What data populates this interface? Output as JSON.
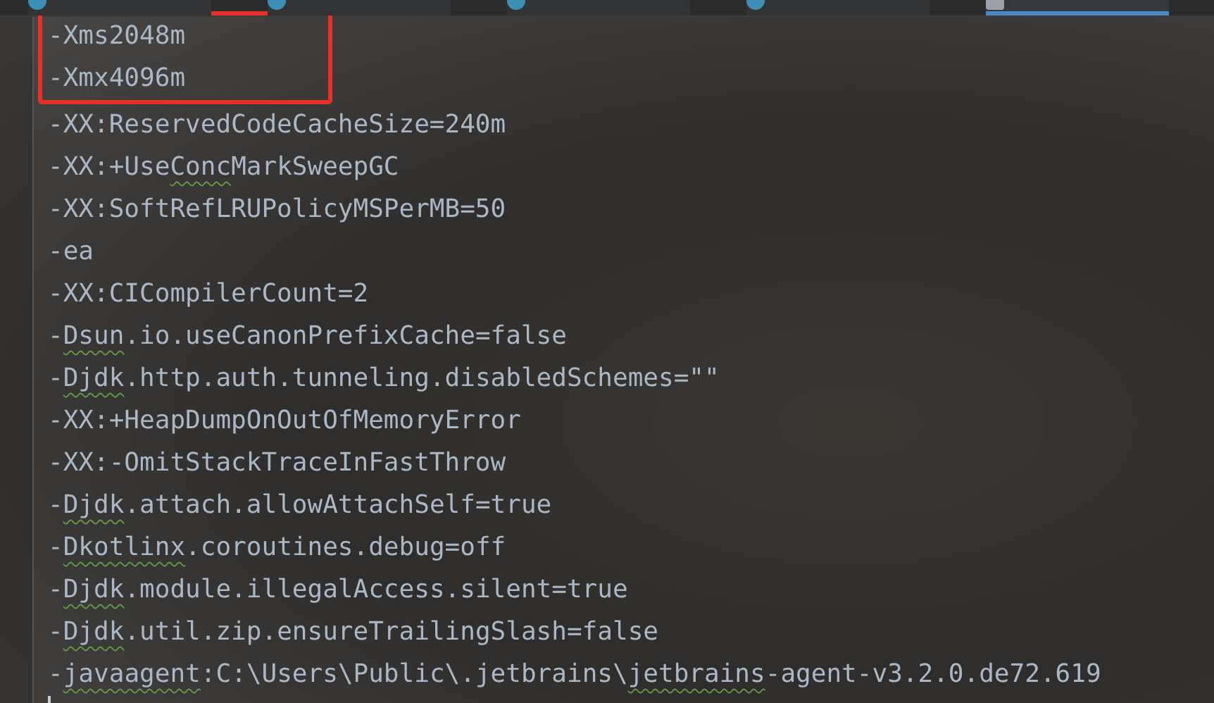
{
  "tabs": [
    {
      "selected": false
    },
    {
      "selected": false
    },
    {
      "selected": false
    },
    {
      "selected": false
    },
    {
      "selected": true
    }
  ],
  "lines": [
    {
      "highlighted": true,
      "segments": [
        {
          "text": "-Xms2048m",
          "warning": false
        }
      ]
    },
    {
      "highlighted": true,
      "segments": [
        {
          "text": "-Xmx4096m",
          "warning": false
        }
      ]
    },
    {
      "highlighted": false,
      "segments": [
        {
          "text": "-XX:ReservedCodeCacheSize=240m",
          "warning": false
        }
      ]
    },
    {
      "highlighted": false,
      "segments": [
        {
          "text": "-XX:+Use",
          "warning": false
        },
        {
          "text": "Conc",
          "warning": true
        },
        {
          "text": "MarkSweepGC",
          "warning": false
        }
      ]
    },
    {
      "highlighted": false,
      "segments": [
        {
          "text": "-XX:SoftRefLRUPolicyMSPerMB=50",
          "warning": false
        }
      ]
    },
    {
      "highlighted": false,
      "segments": [
        {
          "text": "-ea",
          "warning": false
        }
      ]
    },
    {
      "highlighted": false,
      "segments": [
        {
          "text": "-XX:CICompilerCount=2",
          "warning": false
        }
      ]
    },
    {
      "highlighted": false,
      "segments": [
        {
          "text": "-",
          "warning": false
        },
        {
          "text": "Dsun",
          "warning": true
        },
        {
          "text": ".io.useCanonPrefixCache=false",
          "warning": false
        }
      ]
    },
    {
      "highlighted": false,
      "segments": [
        {
          "text": "-",
          "warning": false
        },
        {
          "text": "Djdk",
          "warning": true
        },
        {
          "text": ".http.auth.tunneling.disabledSchemes=\"\"",
          "warning": false
        }
      ]
    },
    {
      "highlighted": false,
      "segments": [
        {
          "text": "-XX:+HeapDumpOnOutOfMemoryError",
          "warning": false
        }
      ]
    },
    {
      "highlighted": false,
      "segments": [
        {
          "text": "-XX:-OmitStackTraceInFastThrow",
          "warning": false
        }
      ]
    },
    {
      "highlighted": false,
      "segments": [
        {
          "text": "-",
          "warning": false
        },
        {
          "text": "Djdk",
          "warning": true
        },
        {
          "text": ".attach.allowAttachSelf=true",
          "warning": false
        }
      ]
    },
    {
      "highlighted": false,
      "segments": [
        {
          "text": "-",
          "warning": false
        },
        {
          "text": "Dkotlinx",
          "warning": true
        },
        {
          "text": ".coroutines.debug=off",
          "warning": false
        }
      ]
    },
    {
      "highlighted": false,
      "segments": [
        {
          "text": "-",
          "warning": false
        },
        {
          "text": "Djdk",
          "warning": true
        },
        {
          "text": ".module.illegalAccess.silent=true",
          "warning": false
        }
      ]
    },
    {
      "highlighted": false,
      "segments": [
        {
          "text": "-",
          "warning": false
        },
        {
          "text": "Djdk",
          "warning": true
        },
        {
          "text": ".util.zip.ensureTrailingSlash=false",
          "warning": false
        }
      ]
    },
    {
      "highlighted": false,
      "segments": [
        {
          "text": "-",
          "warning": false
        },
        {
          "text": "javaagent",
          "warning": true
        },
        {
          "text": ":C:\\Users\\Public\\.jetbrains\\",
          "warning": false
        },
        {
          "text": "jetbrains",
          "warning": true
        },
        {
          "text": "-agent-v3.2.0.de72.619",
          "warning": false
        }
      ]
    }
  ]
}
